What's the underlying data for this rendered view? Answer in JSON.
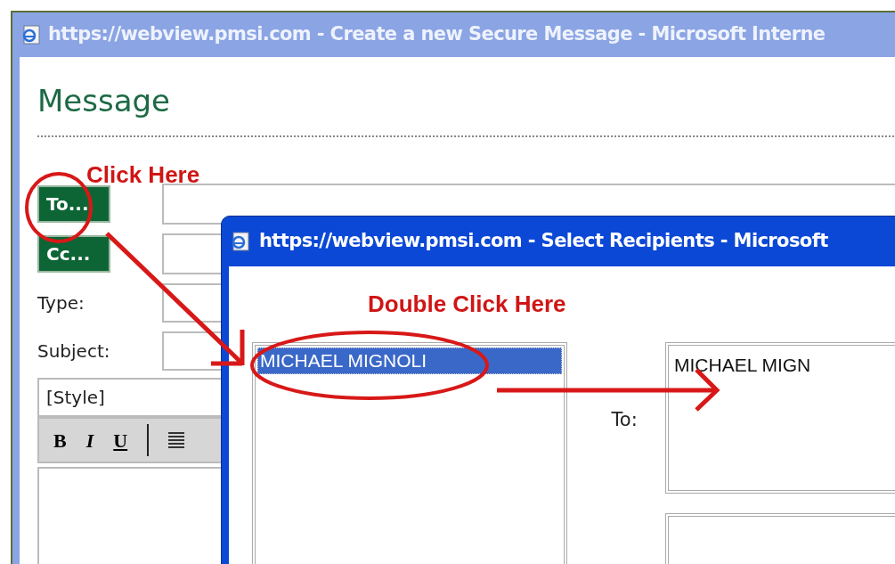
{
  "main_window": {
    "title": "https://webview.pmsi.com - Create a new Secure Message - Microsoft Interne",
    "heading": "Message",
    "recipient_buttons": [
      "To...",
      "Cc..."
    ],
    "labels": [
      "Type:",
      "Subject:"
    ],
    "style_select": "[Style]",
    "toolbar": [
      {
        "kind": "bold",
        "label": "B"
      },
      {
        "kind": "italic",
        "label": "I"
      },
      {
        "kind": "underline",
        "label": "U"
      }
    ]
  },
  "popup": {
    "title": "https://webview.pmsi.com - Select Recipients - Microsoft",
    "names": [
      {
        "name": "MICHAEL MIGNOLI",
        "selected": true
      }
    ],
    "to_label": "To:",
    "to_value": "MICHAEL MIGN"
  },
  "annotations": [
    {
      "text": "Click Here"
    },
    {
      "text": "Double Click Here"
    }
  ]
}
